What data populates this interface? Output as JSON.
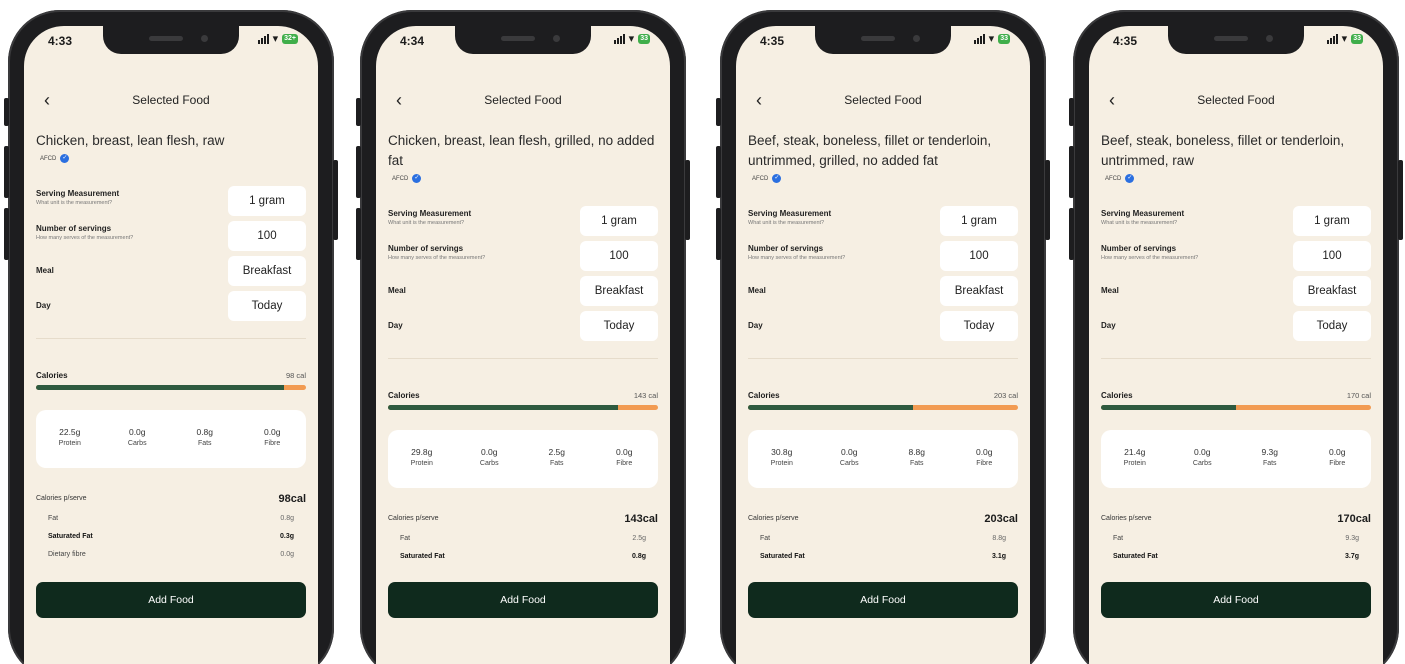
{
  "phones": [
    {
      "time": "4:33",
      "battery": "32+",
      "nav_title": "Selected Food",
      "food_name": "Chicken, breast, lean flesh, raw",
      "source_badge": "AFCD",
      "serving_measurement_label": "Serving Measurement",
      "serving_measurement_sub": "What unit is the measurement?",
      "serving_measurement_value": "1 gram",
      "servings_label": "Number of servings",
      "servings_sub": "How many serves of the measurement?",
      "servings_value": "100",
      "meal_label": "Meal",
      "meal_value": "Breakfast",
      "day_label": "Day",
      "day_value": "Today",
      "calories_label": "Calories",
      "calories_value": "98 cal",
      "calorie_bar_fill": 0.92,
      "macros": [
        {
          "value": "22.5g",
          "label": "Protein"
        },
        {
          "value": "0.0g",
          "label": "Carbs"
        },
        {
          "value": "0.8g",
          "label": "Fats"
        },
        {
          "value": "0.0g",
          "label": "Fibre"
        }
      ],
      "per_serve_label": "Calories p/serve",
      "per_serve_value": "98cal",
      "nutrients": [
        {
          "label": "Fat",
          "value": "0.8g",
          "bold": false
        },
        {
          "label": "Saturated Fat",
          "value": "0.3g",
          "bold": true
        },
        {
          "label": "Dietary fibre",
          "value": "0.0g",
          "bold": false
        }
      ],
      "add_button": "Add Food"
    },
    {
      "time": "4:34",
      "battery": "33",
      "nav_title": "Selected Food",
      "food_name": "Chicken, breast, lean flesh, grilled, no added fat",
      "source_badge": "AFCD",
      "serving_measurement_label": "Serving Measurement",
      "serving_measurement_sub": "What unit is the measurement?",
      "serving_measurement_value": "1 gram",
      "servings_label": "Number of servings",
      "servings_sub": "How many serves of the measurement?",
      "servings_value": "100",
      "meal_label": "Meal",
      "meal_value": "Breakfast",
      "day_label": "Day",
      "day_value": "Today",
      "calories_label": "Calories",
      "calories_value": "143 cal",
      "calorie_bar_fill": 0.85,
      "macros": [
        {
          "value": "29.8g",
          "label": "Protein"
        },
        {
          "value": "0.0g",
          "label": "Carbs"
        },
        {
          "value": "2.5g",
          "label": "Fats"
        },
        {
          "value": "0.0g",
          "label": "Fibre"
        }
      ],
      "per_serve_label": "Calories p/serve",
      "per_serve_value": "143cal",
      "nutrients": [
        {
          "label": "Fat",
          "value": "2.5g",
          "bold": false
        },
        {
          "label": "Saturated Fat",
          "value": "0.8g",
          "bold": true
        }
      ],
      "add_button": "Add Food"
    },
    {
      "time": "4:35",
      "battery": "33",
      "nav_title": "Selected Food",
      "food_name": "Beef, steak, boneless, fillet or tenderloin, untrimmed, grilled, no added fat",
      "source_badge": "AFCD",
      "serving_measurement_label": "Serving Measurement",
      "serving_measurement_sub": "What unit is the measurement?",
      "serving_measurement_value": "1 gram",
      "servings_label": "Number of servings",
      "servings_sub": "How many serves of the measurement?",
      "servings_value": "100",
      "meal_label": "Meal",
      "meal_value": "Breakfast",
      "day_label": "Day",
      "day_value": "Today",
      "calories_label": "Calories",
      "calories_value": "203 cal",
      "calorie_bar_fill": 0.61,
      "macros": [
        {
          "value": "30.8g",
          "label": "Protein"
        },
        {
          "value": "0.0g",
          "label": "Carbs"
        },
        {
          "value": "8.8g",
          "label": "Fats"
        },
        {
          "value": "0.0g",
          "label": "Fibre"
        }
      ],
      "per_serve_label": "Calories p/serve",
      "per_serve_value": "203cal",
      "nutrients": [
        {
          "label": "Fat",
          "value": "8.8g",
          "bold": false
        },
        {
          "label": "Saturated Fat",
          "value": "3.1g",
          "bold": true
        }
      ],
      "add_button": "Add Food"
    },
    {
      "time": "4:35",
      "battery": "33",
      "nav_title": "Selected Food",
      "food_name": "Beef, steak, boneless, fillet or tenderloin, untrimmed, raw",
      "source_badge": "AFCD",
      "serving_measurement_label": "Serving Measurement",
      "serving_measurement_sub": "What unit is the measurement?",
      "serving_measurement_value": "1 gram",
      "servings_label": "Number of servings",
      "servings_sub": "How many serves of the measurement?",
      "servings_value": "100",
      "meal_label": "Meal",
      "meal_value": "Breakfast",
      "day_label": "Day",
      "day_value": "Today",
      "calories_label": "Calories",
      "calories_value": "170 cal",
      "calorie_bar_fill": 0.5,
      "macros": [
        {
          "value": "21.4g",
          "label": "Protein"
        },
        {
          "value": "0.0g",
          "label": "Carbs"
        },
        {
          "value": "9.3g",
          "label": "Fats"
        },
        {
          "value": "0.0g",
          "label": "Fibre"
        }
      ],
      "per_serve_label": "Calories p/serve",
      "per_serve_value": "170cal",
      "nutrients": [
        {
          "label": "Fat",
          "value": "9.3g",
          "bold": false
        },
        {
          "label": "Saturated Fat",
          "value": "3.7g",
          "bold": true
        }
      ],
      "add_button": "Add Food"
    }
  ]
}
